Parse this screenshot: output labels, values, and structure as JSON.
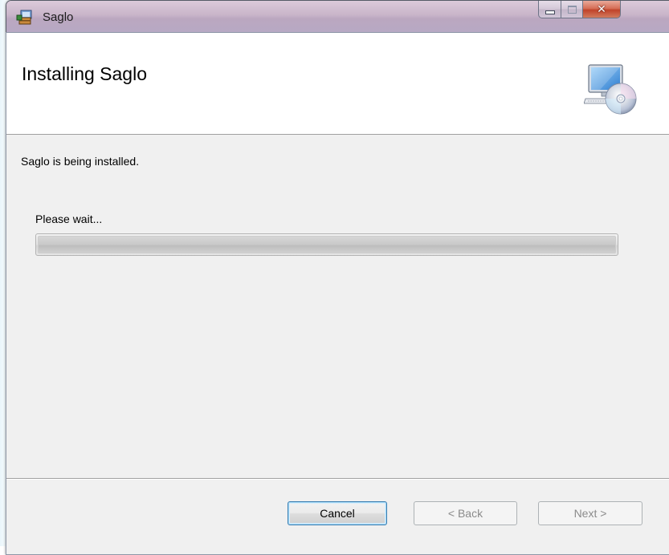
{
  "window": {
    "title": "Saglo",
    "app_icon": "installer-package-icon",
    "controls": {
      "minimize_icon": "minimize-icon",
      "maximize_icon": "maximize-icon",
      "close_icon": "close-icon",
      "close_glyph": "✕"
    }
  },
  "banner": {
    "title": "Installing Saglo",
    "icon": "computer-cd-icon"
  },
  "body": {
    "status_text": "Saglo is being installed.",
    "wait_text": "Please wait...",
    "progress_fraction": 0
  },
  "buttons": {
    "cancel_label": "Cancel",
    "back_label": "< Back",
    "next_label": "Next >"
  },
  "colors": {
    "client_bg": "#f0f0f0",
    "banner_bg": "#ffffff",
    "cancel_focus_border": "#3c7fb1",
    "disabled_text": "#8b8b8b"
  }
}
